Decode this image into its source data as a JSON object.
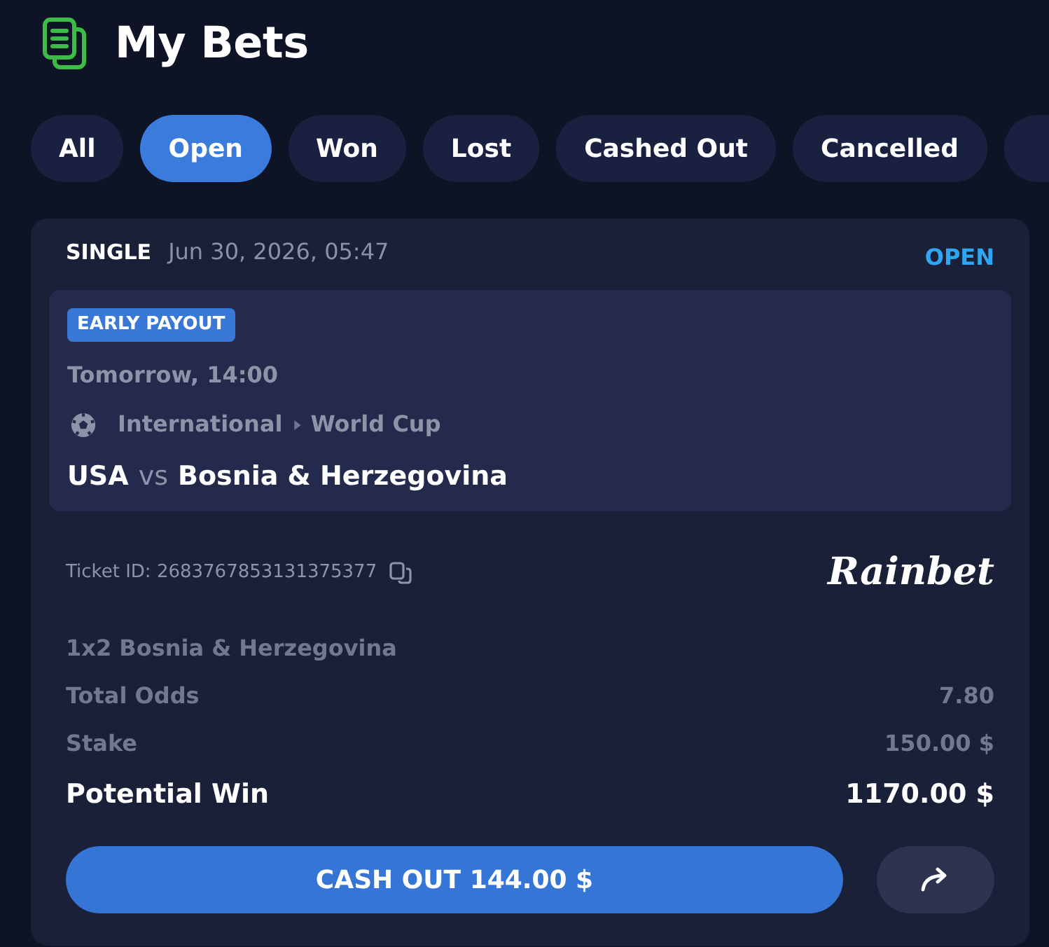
{
  "header": {
    "title": "My Bets"
  },
  "tabs": [
    {
      "label": "All",
      "selected": false
    },
    {
      "label": "Open",
      "selected": true
    },
    {
      "label": "Won",
      "selected": false
    },
    {
      "label": "Lost",
      "selected": false
    },
    {
      "label": "Cashed Out",
      "selected": false
    },
    {
      "label": "Cancelled",
      "selected": false
    },
    {
      "selected": false
    }
  ],
  "bet": {
    "type": "SINGLE",
    "placed": "Jun 30, 2026, 05:47",
    "status": "OPEN",
    "event": {
      "badge": "EARLY PAYOUT",
      "start_time": "Tomorrow, 14:00",
      "category": "International",
      "competition": "World Cup",
      "home": "USA",
      "separator": "vs",
      "away": "Bosnia & Herzegovina"
    },
    "ticket_id": "Ticket ID: 2683767853131375377",
    "logo": "Rainbet",
    "selection": "1x2 Bosnia & Herzegovina",
    "rows": [
      {
        "kind": "muted",
        "label": "Total Odds",
        "value": "7.80"
      },
      {
        "kind": "muted",
        "label": "Stake",
        "value": "150.00 $"
      },
      {
        "kind": "total",
        "label": "Potential Win",
        "value": "1170.00 $"
      }
    ],
    "cash_out": {
      "label": "CASH OUT 144.00 $"
    }
  }
}
